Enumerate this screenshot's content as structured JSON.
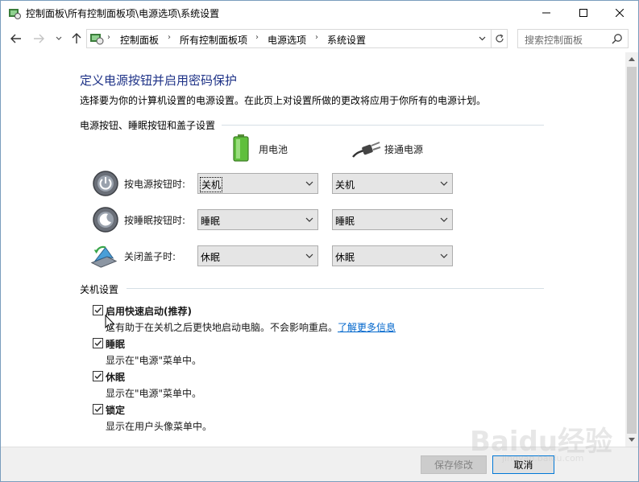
{
  "window": {
    "title": "控制面板\\所有控制面板项\\电源选项\\系统设置",
    "icon": "control-panel-icon",
    "controls": {
      "minimize": "minimize-icon",
      "maximize": "maximize-icon",
      "close": "close-icon"
    }
  },
  "navigation": {
    "back": "back-arrow-icon",
    "forward": "forward-arrow-icon",
    "recent": "chevron-down-icon",
    "up": "up-arrow-icon",
    "breadcrumbs": [
      "控制面板",
      "所有控制面板项",
      "电源选项",
      "系统设置"
    ],
    "refresh": "refresh-icon"
  },
  "search": {
    "placeholder": "搜索控制面板",
    "icon": "search-icon"
  },
  "main": {
    "title": "定义电源按钮并启用密码保护",
    "description": "选择要为你的计算机设置的电源设置。在此页上对设置所做的更改将应用于你所有的电源计划。",
    "power_section": {
      "heading": "电源按钮、睡眠按钮和盖子设置",
      "columns": [
        {
          "label": "用电池",
          "icon": "battery-icon"
        },
        {
          "label": "接通电源",
          "icon": "power-plug-icon"
        }
      ],
      "rows": [
        {
          "label": "按电源按钮时:",
          "icon": "power-button-icon",
          "battery": "关机",
          "plugged": "关机"
        },
        {
          "label": "按睡眠按钮时:",
          "icon": "sleep-button-icon",
          "battery": "睡眠",
          "plugged": "睡眠"
        },
        {
          "label": "关闭盖子时:",
          "icon": "laptop-lid-icon",
          "battery": "休眠",
          "plugged": "休眠"
        }
      ]
    },
    "shutdown_section": {
      "heading": "关机设置",
      "options": [
        {
          "label": "启用快速启动(推荐)",
          "description": "这有助于在关机之后更快地启动电脑。不会影响重启。",
          "link": "了解更多信息",
          "checked": true
        },
        {
          "label": "睡眠",
          "description": "显示在\"电源\"菜单中。",
          "checked": true
        },
        {
          "label": "休眠",
          "description": "显示在\"电源\"菜单中。",
          "checked": true
        },
        {
          "label": "锁定",
          "description": "显示在用户头像菜单中。",
          "checked": true
        }
      ]
    }
  },
  "footer": {
    "save_label": "保存修改",
    "cancel_label": "取消"
  },
  "watermark": {
    "text": "Baidu经验",
    "url": "jingyan.baidu.com"
  },
  "colors": {
    "title": "#1e3287",
    "link": "#0066cc",
    "accent_border": "#0078d7"
  }
}
